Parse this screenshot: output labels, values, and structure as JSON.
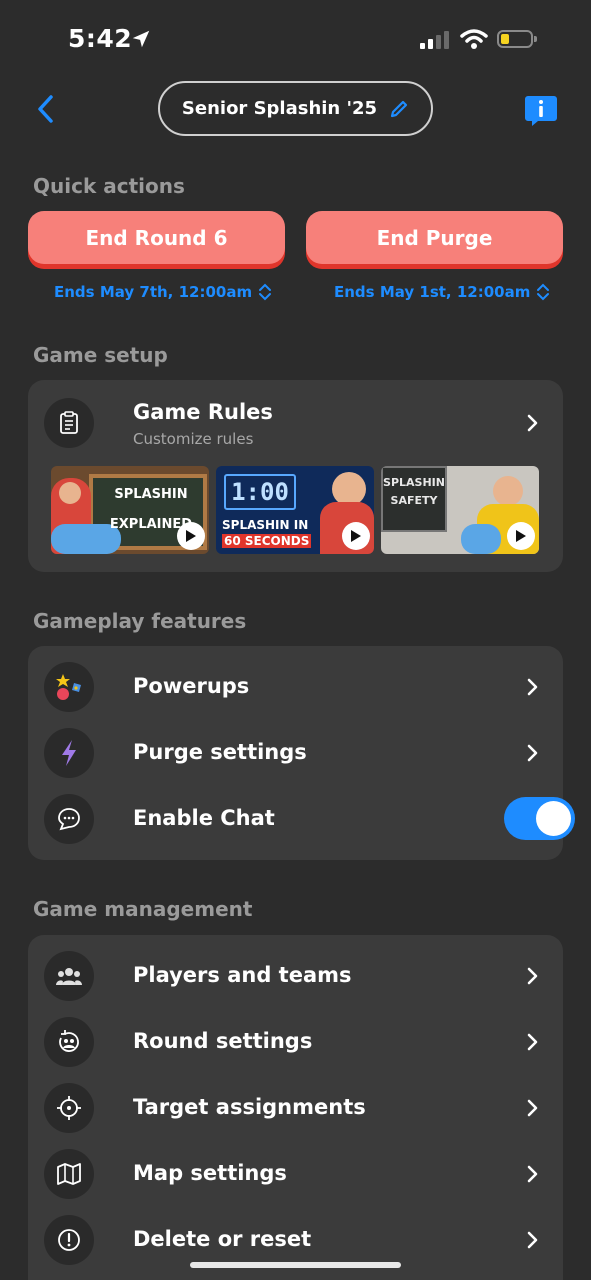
{
  "status": {
    "time": "5:42"
  },
  "header": {
    "title": "Senior Splashin '25"
  },
  "quick_actions": {
    "heading": "Quick actions",
    "end_round": {
      "label": "End Round 6",
      "sub": "Ends May 7th, 12:00am"
    },
    "end_purge": {
      "label": "End Purge",
      "sub": "Ends May 1st, 12:00am"
    }
  },
  "game_setup": {
    "heading": "Game setup",
    "rules": {
      "label": "Game Rules",
      "sub": "Customize rules"
    },
    "videos": [
      {
        "text": "SPLASHIN EXPLAINED"
      },
      {
        "clock": "1:00",
        "text1": "SPLASHIN IN",
        "text2": "60 SECONDS"
      },
      {
        "text": "SPLASHIN SAFETY"
      }
    ]
  },
  "gameplay": {
    "heading": "Gameplay features",
    "items": [
      {
        "label": "Powerups"
      },
      {
        "label": "Purge settings"
      },
      {
        "label": "Enable Chat",
        "enabled": true
      }
    ]
  },
  "management": {
    "heading": "Game management",
    "items": [
      {
        "label": "Players and teams"
      },
      {
        "label": "Round settings"
      },
      {
        "label": "Target assignments"
      },
      {
        "label": "Map settings"
      },
      {
        "label": "Delete or reset"
      }
    ]
  }
}
